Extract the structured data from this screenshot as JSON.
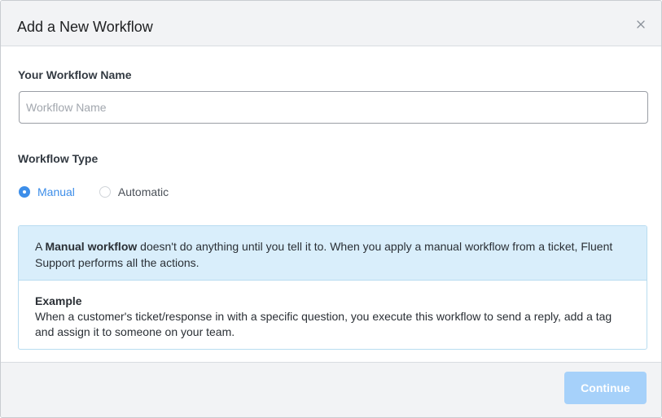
{
  "modal": {
    "title": "Add a New Workflow",
    "close_icon": "close-icon"
  },
  "form": {
    "name_label": "Your Workflow Name",
    "name_placeholder": "Workflow Name",
    "name_value": "",
    "type_label": "Workflow Type",
    "type_options": [
      {
        "label": "Manual",
        "checked": true
      },
      {
        "label": "Automatic",
        "checked": false
      }
    ]
  },
  "info": {
    "prefix": "A ",
    "bold": "Manual workflow",
    "suffix": " doesn't do anything until you tell it to. When you apply a manual workflow from a ticket, Fluent Support performs all the actions.",
    "example_title": "Example",
    "example_text": "When a customer's ticket/response in with a specific question, you execute this workflow to send a reply, add a tag and assign it to someone on your team."
  },
  "footer": {
    "continue_label": "Continue"
  },
  "colors": {
    "accent": "#3d8ee9",
    "button_disabled": "#a6d1fa",
    "info_bg": "#d9eefb"
  }
}
